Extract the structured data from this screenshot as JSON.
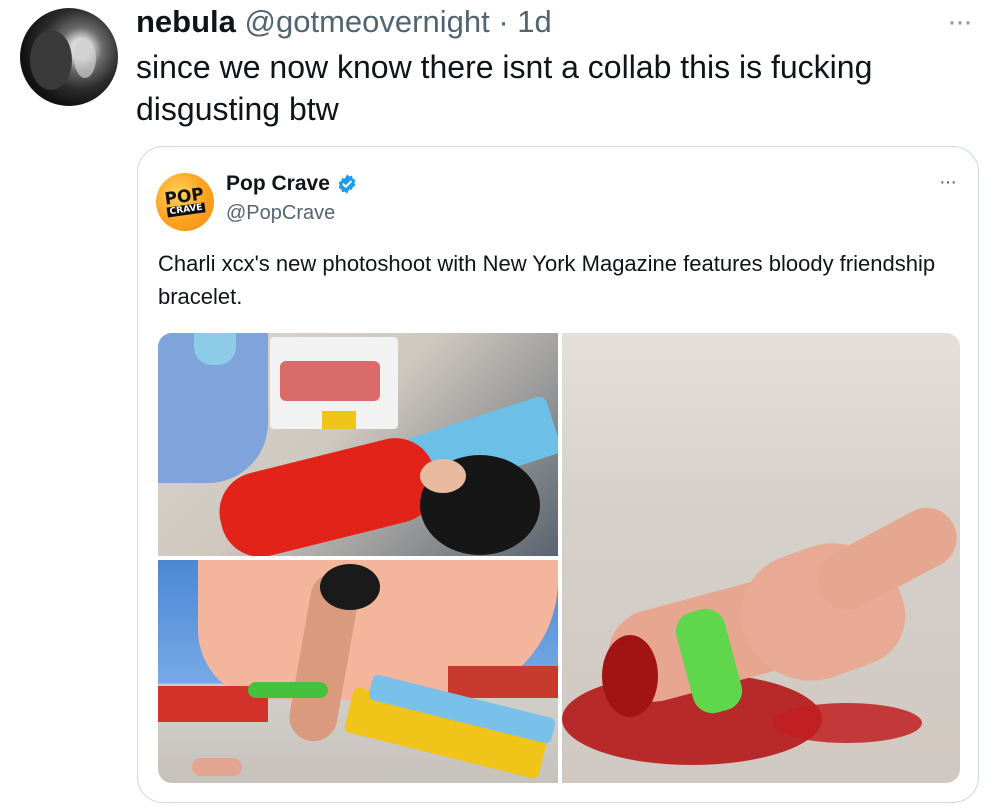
{
  "tweet": {
    "name": "nebula",
    "handle": "@gotmeovernight",
    "separator": "·",
    "time": "1d",
    "more_icon": "···",
    "text": "since we now know there isnt a collab this is fucking disgusting btw"
  },
  "quoted": {
    "avatar": {
      "line1": "POP",
      "line2": "CRAVE"
    },
    "name": "Pop Crave",
    "handle": "@PopCrave",
    "more_icon": "···",
    "text": "Charli xcx's new photoshoot with New York Magazine features bloody friendship bracelet.",
    "verified_color": "#1d9bf0"
  }
}
